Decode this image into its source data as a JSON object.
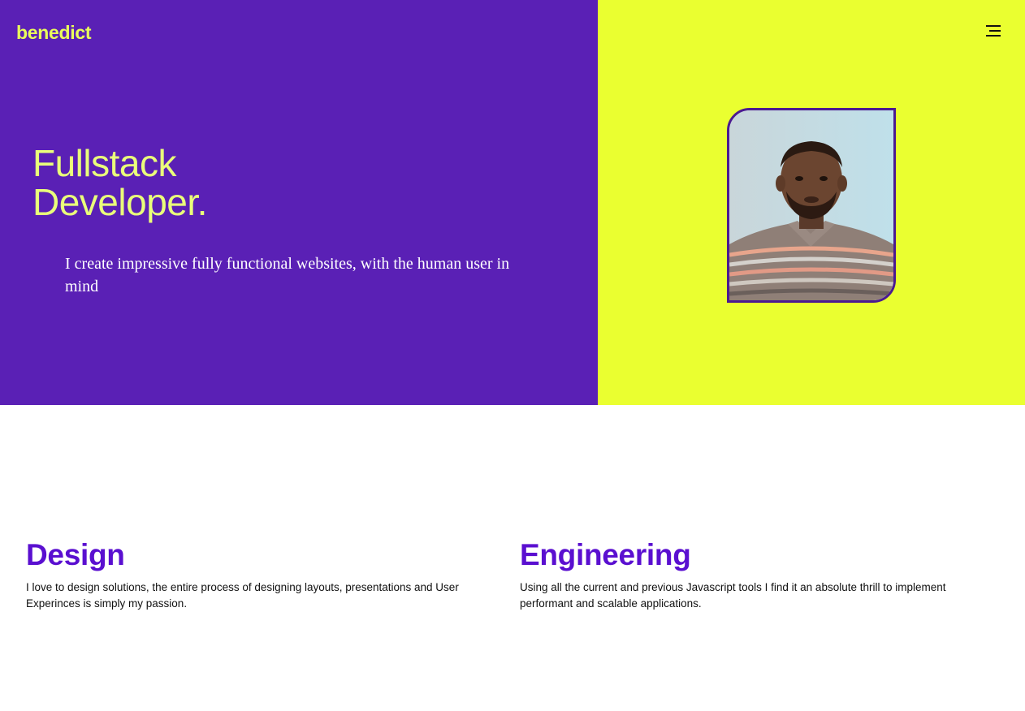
{
  "header": {
    "logo": "benedict",
    "menu_icon": "hamburger-menu-icon"
  },
  "hero": {
    "title_line1": "Fullstack",
    "title_line2": "Developer.",
    "tagline": "I create impressive fully functional websites, with the human user in mind",
    "portrait_alt": "Portrait photo of Benedict"
  },
  "features": {
    "design": {
      "title": "Design",
      "text": "I love to design solutions, the entire process of designing layouts, presentations and User Experinces is simply my passion."
    },
    "engineering": {
      "title": "Engineering",
      "text": "Using all the current and previous Javascript tools I find it an absolute thrill to implement performant and scalable applications."
    }
  },
  "colors": {
    "purple": "#5a20b5",
    "yellow": "#eaff30",
    "heading_purple": "#5a0fd0",
    "headline_yellow": "#eaff7a"
  }
}
